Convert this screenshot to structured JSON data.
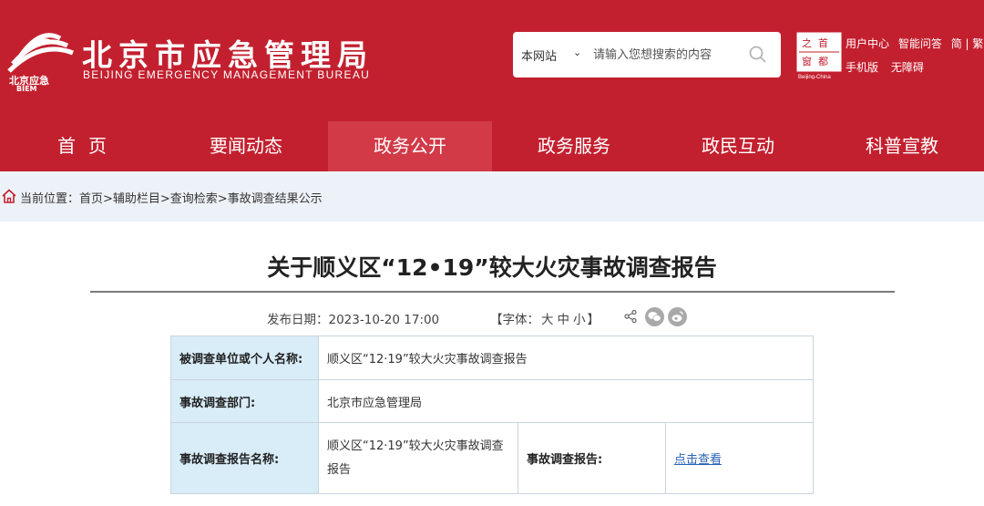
{
  "header": {
    "site_title_cn": "北京市应急管理局",
    "site_title_en": "BEIJING  EMERGENCY MANAGEMENT BUREAU",
    "logo_text": "北京应急 BJEM",
    "search": {
      "scope": "本网站",
      "placeholder": "请输入您想搜索的内容"
    },
    "capital_logo_text": "首都之窗 Beijing-China",
    "links_row1": [
      "用户中心",
      "智能问答",
      "简 | 繁"
    ],
    "links_row2": [
      "手机版",
      "无障碍"
    ]
  },
  "nav": {
    "items": [
      {
        "label": "首页",
        "active": false
      },
      {
        "label": "要闻动态",
        "active": false
      },
      {
        "label": "政务公开",
        "active": true
      },
      {
        "label": "政务服务",
        "active": false
      },
      {
        "label": "政民互动",
        "active": false
      },
      {
        "label": "科普宣教",
        "active": false
      }
    ]
  },
  "breadcrumb": {
    "text": "当前位置：首页>辅助栏目>查询检索>事故调查结果公示"
  },
  "article": {
    "title": "关于顺义区“12•19”较大火灾事故调查报告",
    "publish_date": "发布日期：2023-10-20 17:00",
    "font_label_open": "【字体：",
    "font_sizes": [
      "大",
      "中",
      "小"
    ],
    "font_label_close": "】"
  },
  "table": {
    "row1_label": "被调查单位或个人名称:",
    "row1_value": "顺义区“12·19”较大火灾事故调查报告",
    "row2_label": "事故调查部门:",
    "row2_value": "北京市应急管理局",
    "row3_label": "事故调查报告名称:",
    "row3_value": "顺义区“12·19”较大火灾事故调查报告",
    "row3_label2": "事故调查报告:",
    "row3_link": "点击查看"
  },
  "colors": {
    "brand_red": "#c3202f",
    "active_nav": "#d23a47",
    "breadcrumb_bg": "#edf2f8",
    "table_label_bg": "#d9edf8",
    "link": "#2a63b8"
  }
}
